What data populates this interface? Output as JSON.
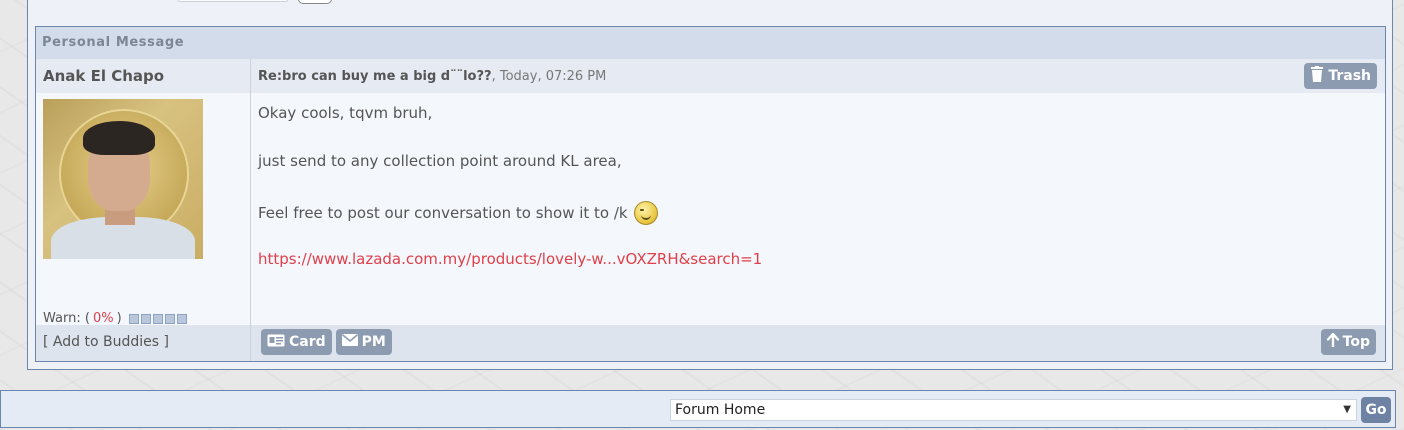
{
  "panel": {
    "title": "Personal Message"
  },
  "post": {
    "author": "Anak El Chapo",
    "subject": "Re:bro can buy me a big d¨¨lo??",
    "timestamp": ", Today, 07:26 PM",
    "trash_label": "Trash",
    "body": {
      "line1": "Okay cools, tqvm bruh,",
      "line2": "just send to any collection point around KL area,",
      "line3": "Feel free to post our conversation to show it to /k",
      "link": "https://www.lazada.com.my/products/lovely-w...vOXZRH&search=1"
    },
    "warn": {
      "prefix": "Warn: (",
      "value": "0%",
      "suffix": ")",
      "level": 0
    }
  },
  "footer": {
    "add_buddies": "[ Add to Buddies ]",
    "card_label": "Card",
    "pm_label": "PM",
    "top_label": "Top"
  },
  "bottom": {
    "select_value": "Forum Home",
    "go_label": "Go"
  },
  "colors": {
    "accent": "#6a86aa",
    "link": "#e0404a",
    "button": "#8c9bb0"
  },
  "icons": [
    "trash-icon",
    "id-card-icon",
    "envelope-icon",
    "arrow-up-icon",
    "wink-smiley-icon",
    "dropdown-caret-icon"
  ]
}
